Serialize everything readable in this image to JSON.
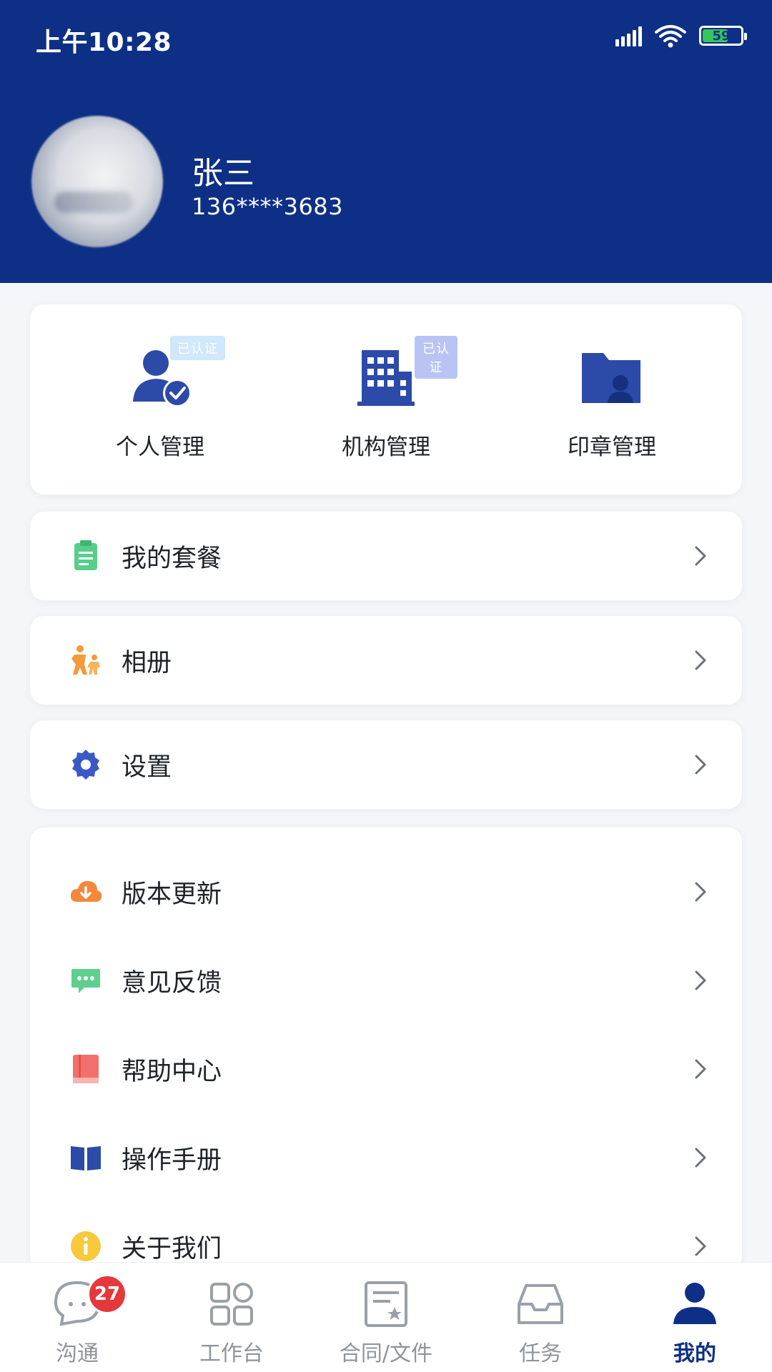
{
  "status_bar": {
    "time": "上午10:28",
    "battery": "59"
  },
  "profile": {
    "name": "张三",
    "phone": "136****3683"
  },
  "quick_actions": [
    {
      "label": "个人管理",
      "badge": "已认证",
      "icon": "person-verified-icon"
    },
    {
      "label": "机构管理",
      "badge": "已认证",
      "icon": "building-icon"
    },
    {
      "label": "印章管理",
      "badge": "",
      "icon": "seal-folder-icon"
    }
  ],
  "menu_single": [
    {
      "label": "我的套餐",
      "icon": "clipboard-icon"
    },
    {
      "label": "相册",
      "icon": "family-icon"
    },
    {
      "label": "设置",
      "icon": "gear-icon"
    }
  ],
  "menu_group": [
    {
      "label": "版本更新",
      "icon": "cloud-download-icon"
    },
    {
      "label": "意见反馈",
      "icon": "chat-bubble-icon"
    },
    {
      "label": "帮助中心",
      "icon": "help-book-icon"
    },
    {
      "label": "操作手册",
      "icon": "open-book-icon"
    },
    {
      "label": "关于我们",
      "icon": "info-icon"
    }
  ],
  "bottom_nav": [
    {
      "label": "沟通",
      "badge": "27",
      "icon": "chat-icon"
    },
    {
      "label": "工作台",
      "icon": "grid-icon"
    },
    {
      "label": "合同/文件",
      "icon": "document-icon"
    },
    {
      "label": "任务",
      "icon": "inbox-icon"
    },
    {
      "label": "我的",
      "icon": "user-icon",
      "active": true
    }
  ],
  "colors": {
    "brand": "#0d2f86",
    "badge": "#e5383b"
  }
}
